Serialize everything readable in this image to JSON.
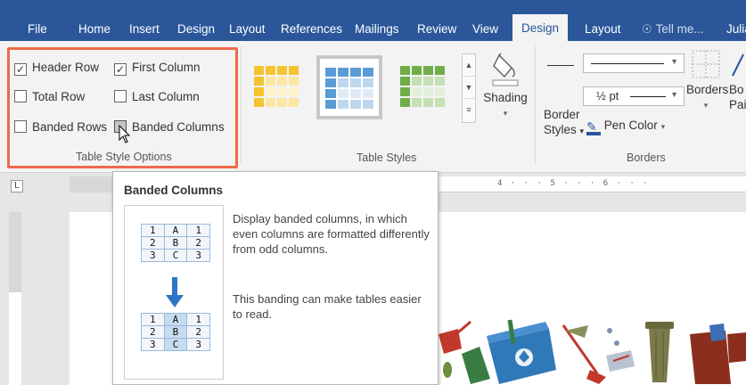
{
  "tabs": [
    {
      "label": "File"
    },
    {
      "label": "Home"
    },
    {
      "label": "Insert"
    },
    {
      "label": "Design"
    },
    {
      "label": "Layout"
    },
    {
      "label": "References"
    },
    {
      "label": "Mailings"
    },
    {
      "label": "Review"
    },
    {
      "label": "View"
    },
    {
      "label": "Design",
      "active": true
    },
    {
      "label": "Layout"
    },
    {
      "label": "Tell me..."
    },
    {
      "label": "Julia"
    }
  ],
  "table_style_options": {
    "group_label": "Table Style Options",
    "options": [
      {
        "label": "Header Row",
        "checked": true
      },
      {
        "label": "First Column",
        "checked": true
      },
      {
        "label": "Total Row",
        "checked": false
      },
      {
        "label": "Last Column",
        "checked": false
      },
      {
        "label": "Banded Rows",
        "checked": false
      },
      {
        "label": "Banded Columns",
        "checked": false,
        "hovered": true
      }
    ]
  },
  "table_styles": {
    "group_label": "Table Styles",
    "shading_label": "Shading",
    "colors": {
      "gold": "#f4c430",
      "blue": "#5b9bd5",
      "green": "#70ad47"
    }
  },
  "borders": {
    "group_label": "Borders",
    "border_styles_line1": "Border",
    "border_styles_line2": "Styles",
    "pen_weight": "½ pt",
    "pen_color": "Pen Color",
    "borders_label": "Borders",
    "border_painter_line1": "Bo",
    "border_painter_line2": "Pai"
  },
  "tooltip": {
    "title": "Banded Columns",
    "description_1": "Display banded columns, in which even columns are formatted differently from odd columns.",
    "description_2": "This banding can make tables easier to read.",
    "table_rows": [
      [
        "1",
        "A",
        "1"
      ],
      [
        "2",
        "B",
        "2"
      ],
      [
        "3",
        "C",
        "3"
      ]
    ]
  },
  "ruler": {
    "corner": "L",
    "marks": "4 · · · 5 · · · 6 · · ·"
  },
  "colors": {
    "ribbon_blue": "#2b579a",
    "highlight": "#ef6a4b"
  }
}
